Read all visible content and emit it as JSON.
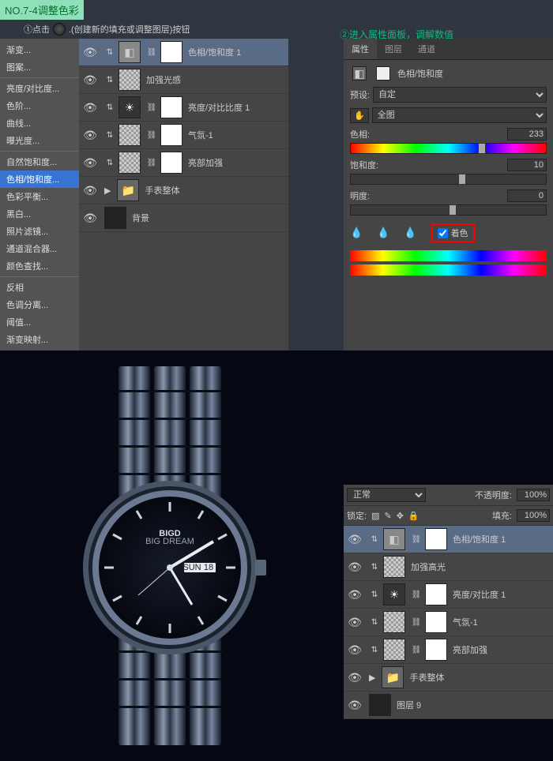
{
  "title_badge": "NO.7-4调整色彩",
  "instruction1": "①点击",
  "instruction1b": ".(创建新的填充或调整图层)按钮",
  "instruction2": "②进入属性面板，调解数值",
  "adj_menu": {
    "items": [
      "渐变...",
      "图案...",
      "亮度/对比度...",
      "色阶...",
      "曲线...",
      "曝光度...",
      "自然饱和度...",
      "色相/饱和度...",
      "色彩平衡...",
      "黑白...",
      "照片滤镜...",
      "通道混合器...",
      "颜色查找...",
      "反相",
      "色调分离...",
      "阈值...",
      "渐变映射..."
    ],
    "selected_index": 7
  },
  "layers_top": [
    {
      "name": "色相/饱和度 1",
      "thumb": "adj",
      "mask": true,
      "sel": true
    },
    {
      "name": "加强光感",
      "thumb": "tex"
    },
    {
      "name": "亮度/对比比度 1",
      "thumb": "sun",
      "mask": true
    },
    {
      "name": "气氛-1",
      "thumb": "tex",
      "mask": true
    },
    {
      "name": "亮部加强",
      "thumb": "tex",
      "mask": true
    },
    {
      "name": "手表整体",
      "thumb": "folder"
    },
    {
      "name": "背景",
      "thumb": "solid"
    }
  ],
  "props": {
    "tabs": [
      "属性",
      "图层",
      "通道"
    ],
    "title": "色相/饱和度",
    "preset_label": "预设:",
    "preset_value": "自定",
    "scope": "全图",
    "hue": {
      "label": "色相:",
      "value": "233"
    },
    "sat": {
      "label": "饱和度:",
      "value": "10"
    },
    "light": {
      "label": "明度:",
      "value": "0"
    },
    "colorize": "着色"
  },
  "layers2": {
    "blend": "正常",
    "opacity_label": "不透明度:",
    "opacity": "100%",
    "lock_label": "锁定:",
    "fill_label": "填充:",
    "fill": "100%",
    "items": [
      {
        "name": "色相/饱和度 1",
        "thumb": "adj",
        "mask": true,
        "sel": true
      },
      {
        "name": "加强高光",
        "thumb": "tex"
      },
      {
        "name": "亮度/对比度 1",
        "thumb": "sun",
        "mask": true
      },
      {
        "name": "气氛-1",
        "thumb": "tex",
        "mask": true
      },
      {
        "name": "亮部加强",
        "thumb": "tex",
        "mask": true
      },
      {
        "name": "手表整体",
        "thumb": "folder"
      },
      {
        "name": "图层 9",
        "thumb": "solid"
      }
    ]
  },
  "watch": {
    "brand": "BIGD",
    "sub": "BIG DREAM",
    "day": "SUN",
    "date": "18"
  }
}
